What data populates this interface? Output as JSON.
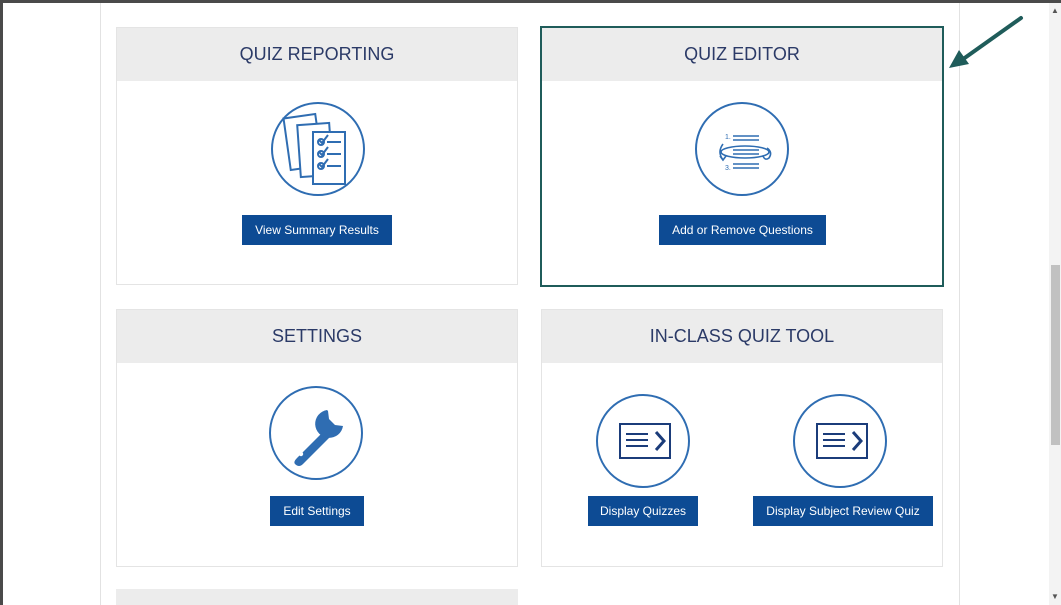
{
  "cards": {
    "quiz_reporting": {
      "title": "QUIZ REPORTING",
      "icon": "checklist-icon",
      "button_label": "View Summary Results"
    },
    "quiz_editor": {
      "title": "QUIZ EDITOR",
      "icon": "reorder-list-icon",
      "button_label": "Add or Remove Questions"
    },
    "settings": {
      "title": "SETTINGS",
      "icon": "wrench-icon",
      "button_label": "Edit Settings"
    },
    "in_class_quiz_tool": {
      "title": "IN-CLASS QUIZ TOOL",
      "icon": "display-arrow-icon",
      "buttons": [
        "Display Quizzes",
        "Display Subject Review Quiz"
      ]
    }
  },
  "colors": {
    "header_bg": "#ececec",
    "header_text": "#2b3a67",
    "button_bg": "#0d4b94",
    "icon_stroke": "#2f6db2",
    "highlight_border": "#1f5c5a",
    "annotation_arrow": "#1f5c5a"
  }
}
